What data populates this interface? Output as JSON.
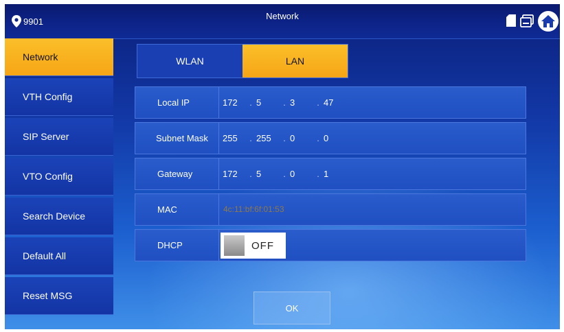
{
  "header": {
    "room_number": "9901",
    "title": "Network",
    "icons": [
      "location-pin-icon",
      "sd-card-icon",
      "storage-icon",
      "home-icon"
    ]
  },
  "sidebar": {
    "items": [
      {
        "label": "Network",
        "active": true
      },
      {
        "label": "VTH Config",
        "active": false
      },
      {
        "label": "SIP Server",
        "active": false
      },
      {
        "label": "VTO Config",
        "active": false
      },
      {
        "label": "Search Device",
        "active": false
      },
      {
        "label": "Default All",
        "active": false
      },
      {
        "label": "Reset MSG",
        "active": false
      }
    ]
  },
  "tabs": [
    {
      "label": "WLAN",
      "active": false
    },
    {
      "label": "LAN",
      "active": true
    }
  ],
  "form": {
    "local_ip": {
      "label": "Local IP",
      "octets": [
        "172",
        "5",
        "3",
        "47"
      ]
    },
    "subnet_mask": {
      "label": "Subnet Mask",
      "octets": [
        "255",
        "255",
        "0",
        "0"
      ]
    },
    "gateway": {
      "label": "Gateway",
      "octets": [
        "172",
        "5",
        "0",
        "1"
      ]
    },
    "mac": {
      "label": "MAC",
      "value": "4c:11:bf:6f:01:53"
    },
    "dhcp": {
      "label": "DHCP",
      "state": "OFF"
    }
  },
  "ok_label": "OK",
  "colors": {
    "accent": "#f6a516",
    "header": "#0d2388",
    "row": "#2454c6"
  }
}
